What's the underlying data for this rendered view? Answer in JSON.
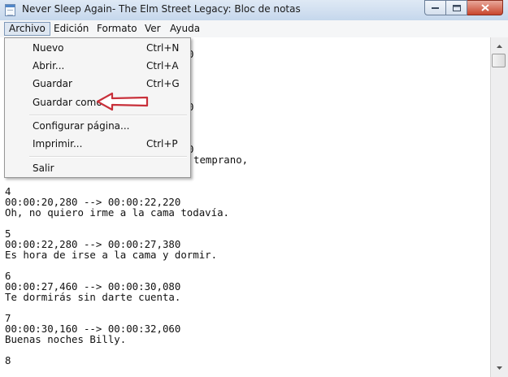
{
  "window": {
    "title": "Never Sleep Again- The Elm Street Legacy: Bloc de notas"
  },
  "menubar": {
    "items": [
      "Archivo",
      "Edición",
      "Formato",
      "Ver",
      "Ayuda"
    ]
  },
  "file_menu": {
    "items": [
      {
        "label": "Nuevo",
        "shortcut": "Ctrl+N"
      },
      {
        "label": "Abrir...",
        "shortcut": "Ctrl+A"
      },
      {
        "label": "Guardar",
        "shortcut": "Ctrl+G"
      },
      {
        "label": "Guardar como...",
        "shortcut": ""
      },
      {
        "label": "Configurar página...",
        "shortcut": ""
      },
      {
        "label": "Imprimir...",
        "shortcut": "Ctrl+P"
      },
      {
        "label": "Salir",
        "shortcut": ""
      }
    ],
    "highlighted_item": "Guardar como..."
  },
  "editor": {
    "partial_lines": [
      "0",
      "0",
      "0",
      "temprano,"
    ],
    "lines": [
      "4",
      "00:00:20,280 --> 00:00:22,220",
      "Oh, no quiero irme a la cama todavía.",
      "",
      "5",
      "00:00:22,280 --> 00:00:27,380",
      "Es hora de irse a la cama y dormir.",
      "",
      "6",
      "00:00:27,460 --> 00:00:30,080",
      "Te dormirás sin darte cuenta.",
      "",
      "7",
      "00:00:30,160 --> 00:00:32,060",
      "Buenas noches Billy.",
      "",
      "8"
    ]
  },
  "colors": {
    "annotation_arrow": "#c8303a",
    "menu_background": "#f5f5f5",
    "title_bar": "#c5d7ec"
  }
}
